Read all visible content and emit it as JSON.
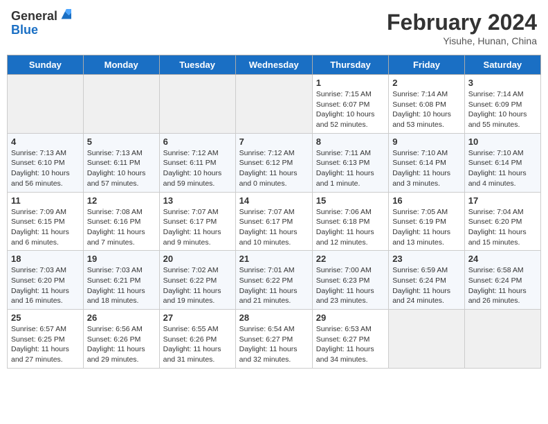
{
  "header": {
    "logo_general": "General",
    "logo_blue": "Blue",
    "title": "February 2024",
    "subtitle": "Yisuhe, Hunan, China"
  },
  "days_of_week": [
    "Sunday",
    "Monday",
    "Tuesday",
    "Wednesday",
    "Thursday",
    "Friday",
    "Saturday"
  ],
  "weeks": [
    [
      {
        "day": "",
        "info": ""
      },
      {
        "day": "",
        "info": ""
      },
      {
        "day": "",
        "info": ""
      },
      {
        "day": "",
        "info": ""
      },
      {
        "day": "1",
        "info": "Sunrise: 7:15 AM\nSunset: 6:07 PM\nDaylight: 10 hours and 52 minutes."
      },
      {
        "day": "2",
        "info": "Sunrise: 7:14 AM\nSunset: 6:08 PM\nDaylight: 10 hours and 53 minutes."
      },
      {
        "day": "3",
        "info": "Sunrise: 7:14 AM\nSunset: 6:09 PM\nDaylight: 10 hours and 55 minutes."
      }
    ],
    [
      {
        "day": "4",
        "info": "Sunrise: 7:13 AM\nSunset: 6:10 PM\nDaylight: 10 hours and 56 minutes."
      },
      {
        "day": "5",
        "info": "Sunrise: 7:13 AM\nSunset: 6:11 PM\nDaylight: 10 hours and 57 minutes."
      },
      {
        "day": "6",
        "info": "Sunrise: 7:12 AM\nSunset: 6:11 PM\nDaylight: 10 hours and 59 minutes."
      },
      {
        "day": "7",
        "info": "Sunrise: 7:12 AM\nSunset: 6:12 PM\nDaylight: 11 hours and 0 minutes."
      },
      {
        "day": "8",
        "info": "Sunrise: 7:11 AM\nSunset: 6:13 PM\nDaylight: 11 hours and 1 minute."
      },
      {
        "day": "9",
        "info": "Sunrise: 7:10 AM\nSunset: 6:14 PM\nDaylight: 11 hours and 3 minutes."
      },
      {
        "day": "10",
        "info": "Sunrise: 7:10 AM\nSunset: 6:14 PM\nDaylight: 11 hours and 4 minutes."
      }
    ],
    [
      {
        "day": "11",
        "info": "Sunrise: 7:09 AM\nSunset: 6:15 PM\nDaylight: 11 hours and 6 minutes."
      },
      {
        "day": "12",
        "info": "Sunrise: 7:08 AM\nSunset: 6:16 PM\nDaylight: 11 hours and 7 minutes."
      },
      {
        "day": "13",
        "info": "Sunrise: 7:07 AM\nSunset: 6:17 PM\nDaylight: 11 hours and 9 minutes."
      },
      {
        "day": "14",
        "info": "Sunrise: 7:07 AM\nSunset: 6:17 PM\nDaylight: 11 hours and 10 minutes."
      },
      {
        "day": "15",
        "info": "Sunrise: 7:06 AM\nSunset: 6:18 PM\nDaylight: 11 hours and 12 minutes."
      },
      {
        "day": "16",
        "info": "Sunrise: 7:05 AM\nSunset: 6:19 PM\nDaylight: 11 hours and 13 minutes."
      },
      {
        "day": "17",
        "info": "Sunrise: 7:04 AM\nSunset: 6:20 PM\nDaylight: 11 hours and 15 minutes."
      }
    ],
    [
      {
        "day": "18",
        "info": "Sunrise: 7:03 AM\nSunset: 6:20 PM\nDaylight: 11 hours and 16 minutes."
      },
      {
        "day": "19",
        "info": "Sunrise: 7:03 AM\nSunset: 6:21 PM\nDaylight: 11 hours and 18 minutes."
      },
      {
        "day": "20",
        "info": "Sunrise: 7:02 AM\nSunset: 6:22 PM\nDaylight: 11 hours and 19 minutes."
      },
      {
        "day": "21",
        "info": "Sunrise: 7:01 AM\nSunset: 6:22 PM\nDaylight: 11 hours and 21 minutes."
      },
      {
        "day": "22",
        "info": "Sunrise: 7:00 AM\nSunset: 6:23 PM\nDaylight: 11 hours and 23 minutes."
      },
      {
        "day": "23",
        "info": "Sunrise: 6:59 AM\nSunset: 6:24 PM\nDaylight: 11 hours and 24 minutes."
      },
      {
        "day": "24",
        "info": "Sunrise: 6:58 AM\nSunset: 6:24 PM\nDaylight: 11 hours and 26 minutes."
      }
    ],
    [
      {
        "day": "25",
        "info": "Sunrise: 6:57 AM\nSunset: 6:25 PM\nDaylight: 11 hours and 27 minutes."
      },
      {
        "day": "26",
        "info": "Sunrise: 6:56 AM\nSunset: 6:26 PM\nDaylight: 11 hours and 29 minutes."
      },
      {
        "day": "27",
        "info": "Sunrise: 6:55 AM\nSunset: 6:26 PM\nDaylight: 11 hours and 31 minutes."
      },
      {
        "day": "28",
        "info": "Sunrise: 6:54 AM\nSunset: 6:27 PM\nDaylight: 11 hours and 32 minutes."
      },
      {
        "day": "29",
        "info": "Sunrise: 6:53 AM\nSunset: 6:27 PM\nDaylight: 11 hours and 34 minutes."
      },
      {
        "day": "",
        "info": ""
      },
      {
        "day": "",
        "info": ""
      }
    ]
  ]
}
